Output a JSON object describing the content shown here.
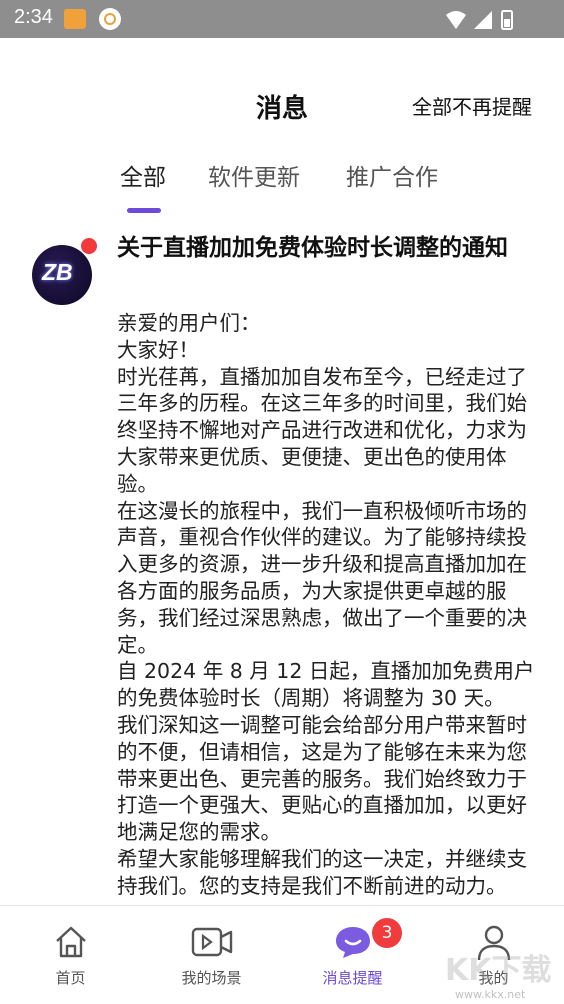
{
  "status_bar": {
    "time": "2:34"
  },
  "header": {
    "title": "消息",
    "mute_all": "全部不再提醒"
  },
  "tabs": [
    {
      "label": "全部",
      "active": true
    },
    {
      "label": "软件更新",
      "active": false
    },
    {
      "label": "推广合作",
      "active": false
    }
  ],
  "message": {
    "avatar_text": "ZB",
    "unread": true,
    "title": "关于直播加加免费体验时长调整的通知",
    "body": [
      "亲爱的用户们：",
      "大家好！",
      "时光荏苒，直播加加自发布至今，已经走过了三年多的历程。在这三年多的时间里，我们始终坚持不懈地对产品进行改进和优化，力求为大家带来更优质、更便捷、更出色的使用体验。",
      "在这漫长的旅程中，我们一直积极倾听市场的声音，重视合作伙伴的建议。为了能够持续投入更多的资源，进一步升级和提高直播加加在各方面的服务品质，为大家提供更卓越的服务，我们经过深思熟虑，做出了一个重要的决定。",
      "自 2024 年 8 月 12 日起，直播加加免费用户的免费体验时长（周期）将调整为 30 天。",
      "我们深知这一调整可能会给部分用户带来暂时的不便，但请相信，这是为了能够在未来为您带来更出色、更完善的服务。我们始终致力于打造一个更强大、更贴心的直播加加，以更好地满足您的需求。",
      "希望大家能够理解我们的这一决定，并继续支持我们。您的支持是我们不断前进的动力。"
    ]
  },
  "bottom_nav": [
    {
      "label": "首页",
      "icon": "home-icon"
    },
    {
      "label": "我的场景",
      "icon": "video-icon"
    },
    {
      "label": "消息提醒",
      "icon": "chat-bubble-icon",
      "active": true,
      "badge": "3"
    },
    {
      "label": "我的",
      "icon": "user-icon"
    }
  ],
  "watermark": {
    "text": "KK下载",
    "url": "www.kkx.net"
  },
  "colors": {
    "accent": "#6b4bd8",
    "badge": "#f03c3c",
    "status_bar": "#8e8e8e"
  }
}
